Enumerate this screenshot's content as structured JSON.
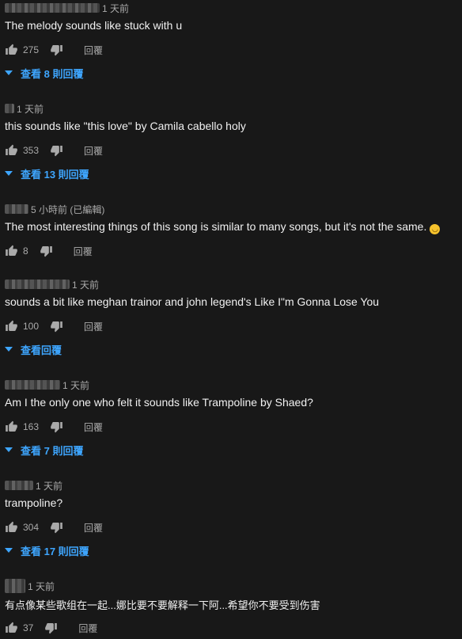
{
  "comments": [
    {
      "time": "1 天前",
      "text": "The melody sounds like stuck with u",
      "likes": "275",
      "reply": "回覆",
      "view_replies": "查看 8 則回覆"
    },
    {
      "time": "1 天前",
      "text": "this sounds like \"this love\" by Camila cabello holy",
      "likes": "353",
      "reply": "回覆",
      "view_replies": "查看 13 則回覆"
    },
    {
      "time": "5 小時前 (已編輯)",
      "text": "The most interesting things of this song is similar to many songs, but it's not the same.",
      "likes": "8",
      "reply": "回覆",
      "emoji": "😆"
    },
    {
      "time": "1 天前",
      "text": "sounds a bit like meghan trainor and john legend's Like I\"m Gonna Lose You",
      "likes": "100",
      "reply": "回覆",
      "view_replies": "查看回覆"
    },
    {
      "time": "1 天前",
      "text": "Am I the only one who felt it sounds like Trampoline by Shaed?",
      "likes": "163",
      "reply": "回覆",
      "view_replies": "查看 7 則回覆"
    },
    {
      "time": "1 天前",
      "text": "trampoline?",
      "likes": "304",
      "reply": "回覆",
      "view_replies": "查看 17 則回覆"
    },
    {
      "time": "1 天前",
      "text": "有点像某些歌组在一起...娜比要不要解释一下阿...希望你不要受到伤害",
      "likes": "37",
      "reply": "回覆"
    }
  ],
  "icons": {
    "like": "thumbs-up-icon",
    "dislike": "thumbs-down-icon",
    "expand": "caret-down-icon"
  },
  "colors": {
    "background": "#181818",
    "text": "#f1f1f1",
    "secondary": "#aaaaaa",
    "link": "#3ea6ff"
  }
}
